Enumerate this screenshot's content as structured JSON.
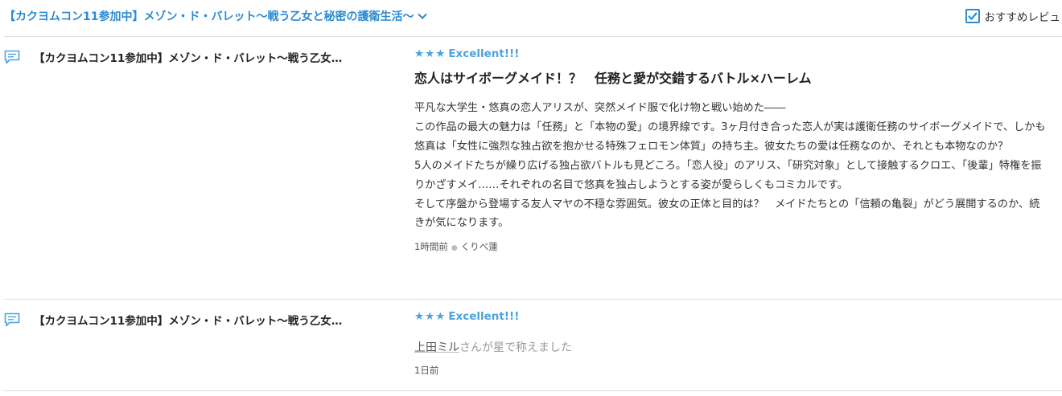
{
  "header": {
    "filter_title": "【カクヨムコン11参加中】メゾン・ド・バレット〜戦う乙女と秘密の護衛生活〜",
    "recommend_label": "おすすめレビュ",
    "recommend_checked": true
  },
  "reviews": [
    {
      "work_title": "【カクヨムコン11参加中】メゾン・ド・バレット〜戦う乙女…",
      "rating_stars": "★★★",
      "rating_label": "Excellent!!!",
      "title": "恋人はサイボーグメイド！？　任務と愛が交錯するバトル×ハーレム",
      "body": [
        "平凡な大学生・悠真の恋人アリスが、突然メイド服で化け物と戦い始めた――",
        "この作品の最大の魅力は「任務」と「本物の愛」の境界線です。3ヶ月付き合った恋人が実は護衛任務のサイボーグメイドで、しかも悠真は「女性に強烈な独占欲を抱かせる特殊フェロモン体質」の持ち主。彼女たちの愛は任務なのか、それとも本物なのか？",
        "5人のメイドたちが繰り広げる独占欲バトルも見どころ。「恋人役」のアリス、「研究対象」として接触するクロエ、「後輩」特権を振りかざすメイ……それぞれの名目で悠真を独占しようとする姿が愛らしくもコミカルです。",
        "そして序盤から登場する友人マヤの不穏な雰囲気。彼女の正体と目的は？　メイドたちとの「信頼の亀裂」がどう展開するのか、続きが気になります。"
      ],
      "time": "1時間前",
      "author": "くりべ蓮"
    },
    {
      "work_title": "【カクヨムコン11参加中】メゾン・ド・バレット〜戦う乙女…",
      "rating_stars": "★★★",
      "rating_label": "Excellent!!!",
      "praise_user": "上田ミル",
      "praise_text": "さんが星で称えました",
      "time": "1日前"
    }
  ],
  "colors": {
    "accent": "#2b8bd1",
    "star": "#4aa3df",
    "divider": "#dcdcdc"
  },
  "icons": [
    "chevron-down-icon",
    "checkbox-check-icon",
    "comment-icon"
  ]
}
